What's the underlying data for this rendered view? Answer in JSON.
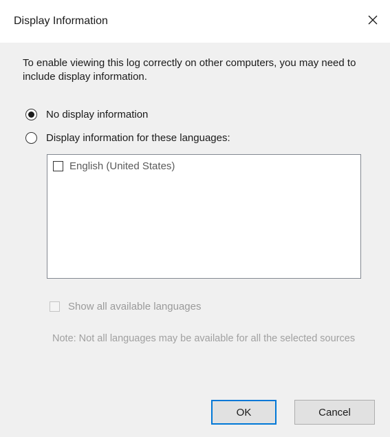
{
  "window": {
    "title": "Display Information",
    "close_icon": "close-icon"
  },
  "intro_text": "To enable viewing this log correctly on other computers, you may need to include display information.",
  "options": {
    "no_display": {
      "label": "No display information",
      "selected": true
    },
    "languages": {
      "label": "Display information for these languages:",
      "selected": false
    }
  },
  "language_list": {
    "items": [
      {
        "label": "English (United States)",
        "checked": false
      }
    ]
  },
  "show_all": {
    "label": "Show all available languages",
    "checked": false,
    "enabled": false
  },
  "note": "Note: Not all languages may be available for all the selected sources",
  "buttons": {
    "ok": "OK",
    "cancel": "Cancel"
  },
  "colors": {
    "dialog_bg": "#f0f0f0",
    "titlebar_bg": "#ffffff",
    "default_button_border": "#0078d7",
    "disabled_text": "#9a9a9a"
  }
}
